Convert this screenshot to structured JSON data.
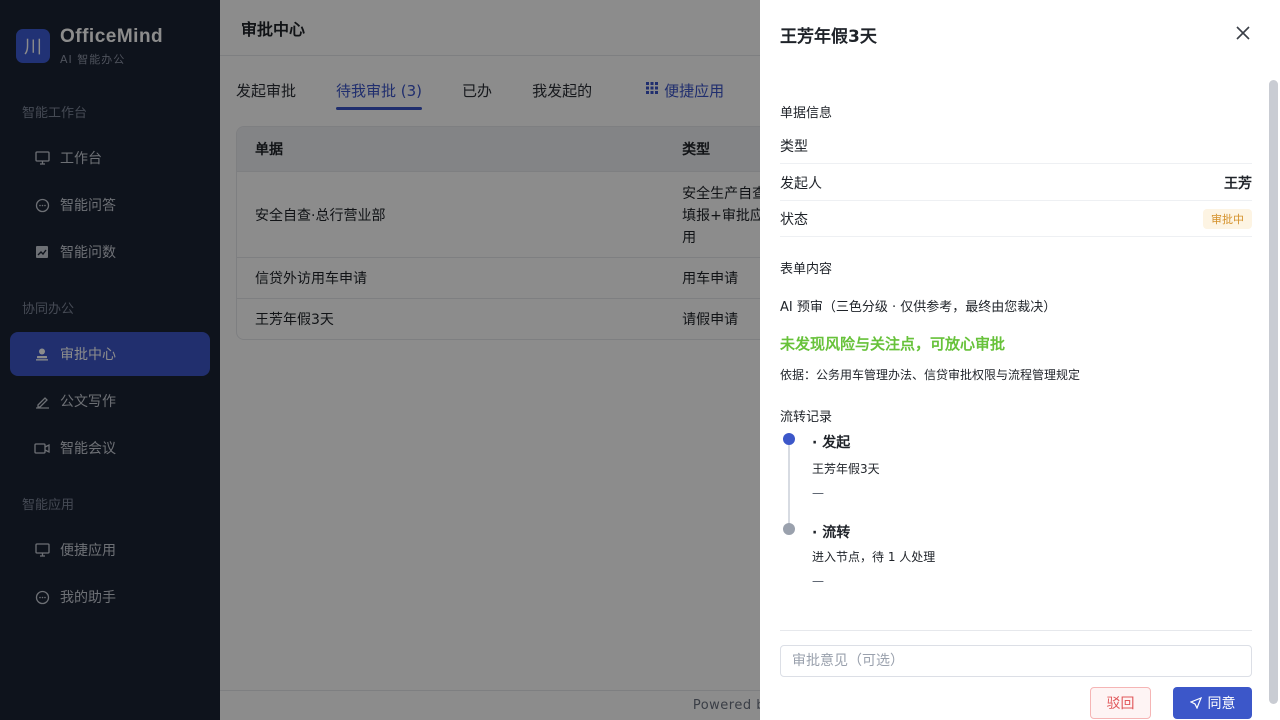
{
  "brand": {
    "name": "OfficeMind",
    "subtitle": "AI 智能办公",
    "logo_glyph": "川"
  },
  "sidebar": {
    "groups": [
      {
        "label": "智能工作台",
        "items": [
          {
            "label": "工作台",
            "icon": "monitor-icon"
          },
          {
            "label": "智能问答",
            "icon": "chat-icon"
          },
          {
            "label": "智能问数",
            "icon": "chart-icon"
          }
        ]
      },
      {
        "label": "协同办公",
        "items": [
          {
            "label": "审批中心",
            "icon": "user-stamp-icon",
            "active": true
          },
          {
            "label": "公文写作",
            "icon": "pen-icon"
          },
          {
            "label": "智能会议",
            "icon": "video-icon"
          }
        ]
      },
      {
        "label": "智能应用",
        "items": [
          {
            "label": "便捷应用",
            "icon": "monitor-icon"
          },
          {
            "label": "我的助手",
            "icon": "chat-icon"
          }
        ]
      }
    ]
  },
  "page": {
    "title": "审批中心"
  },
  "tabs": [
    {
      "label": "发起审批"
    },
    {
      "label": "待我审批 (3)",
      "active": true
    },
    {
      "label": "已办"
    },
    {
      "label": "我发起的"
    },
    {
      "label": "便捷应用",
      "icon": "grid-icon"
    }
  ],
  "table": {
    "headers": [
      "单据",
      "类型"
    ],
    "rows": [
      {
        "doc": "安全自查·总行营业部",
        "type_lines": [
          "安全生产自查",
          "填报+审批应",
          "用"
        ]
      },
      {
        "doc": "信贷外访用车申请",
        "type_lines": [
          "用车申请"
        ]
      },
      {
        "doc": "王芳年假3天",
        "type_lines": [
          "请假申请"
        ]
      }
    ]
  },
  "footer": {
    "text": "Powered by Ling"
  },
  "drawer": {
    "title": "王芳年假3天",
    "doc_info_label": "单据信息",
    "fields": [
      {
        "key": "类型",
        "value": ""
      },
      {
        "key": "发起人",
        "value": "王芳"
      },
      {
        "key": "状态",
        "badge": "审批中"
      }
    ],
    "form_label": "表单内容",
    "ai_heading": "AI 预审（三色分级 · 仅供参考，最终由您裁决）",
    "ai_result": "未发现风险与关注点，可放心审批",
    "ai_basis": "依据：公务用车管理办法、信贷审批权限与流程管理规定",
    "flow_label": "流转记录",
    "timeline": [
      {
        "title": "· 发起",
        "desc": "王芳年假3天",
        "dash": "—"
      },
      {
        "title": "· 流转",
        "desc": "进入节点，待 1 人处理",
        "dash": "—"
      }
    ],
    "comment_placeholder": "审批意见（可选）",
    "reject_label": "驳回",
    "agree_label": "同意"
  },
  "colors": {
    "accent": "#3c57c9",
    "sidebar_bg": "#1b2333",
    "success": "#67c23a",
    "warning": "#d4912a",
    "danger": "#e0575a"
  }
}
